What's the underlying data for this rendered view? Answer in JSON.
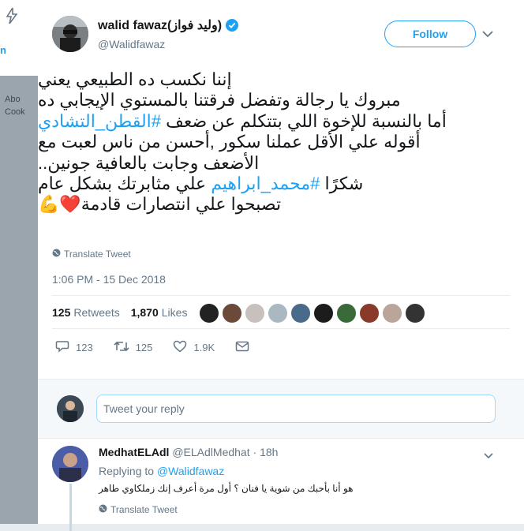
{
  "sidebar": {
    "fragment_label": "n",
    "side_text": "Abo",
    "side_text_2": "Cook"
  },
  "tweet": {
    "author_name": "walid fawaz(وليد فواز)",
    "author_handle": "@Walidfawaz",
    "follow_label": "Follow",
    "lines": [
      {
        "text": "إننا نكسب ده الطبيعي يعني"
      },
      {
        "text": "مبروك يا رجالة وتفضل فرقتنا بالمستوي الإيجابي ده"
      },
      {
        "prefix": "أما بالنسبة للإخوة اللي بتتكلم عن ضعف ",
        "hashtag": "#القطن_التشادي"
      },
      {
        "text": "أقوله علي الأقل عملنا سكور ,أحسن من ناس لعبت مع"
      },
      {
        "text": "الأضعف وجابت بالعافية جونين.."
      },
      {
        "prefix": "شكرًا ",
        "hashtag": "#محمد_ابراهيم",
        "suffix": " علي مثابرتك بشكل عام"
      },
      {
        "text": "تصبحوا علي انتصارات قادمة",
        "emoji": "❤️💪"
      }
    ],
    "translate_label": "Translate Tweet",
    "timestamp": "1:06 PM - 15 Dec 2018",
    "retweets_count": "125",
    "retweets_label": "Retweets",
    "likes_count": "1,870",
    "likes_label": "Likes",
    "likers_count": 10,
    "actions": {
      "replies": "123",
      "retweets": "125",
      "likes": "1.9K"
    }
  },
  "reply_box": {
    "placeholder": "Tweet your reply"
  },
  "reply": {
    "author_name": "MedhatELAdl",
    "author_handle": "@ELAdlMedhat",
    "time": "· 18h",
    "replying_prefix": "Replying to",
    "replying_handle": "@Walidfawaz",
    "text": "هو أنا بأحبك من شوية يا فنان ؟ أول مرة أعرف إنك زملكاوي طاهر",
    "translate_label": "Translate Tweet"
  },
  "colors": {
    "accent": "#1da1f2",
    "heart": "#e0245e",
    "muted": "#657786",
    "backdrop": "#e6ecf0"
  }
}
